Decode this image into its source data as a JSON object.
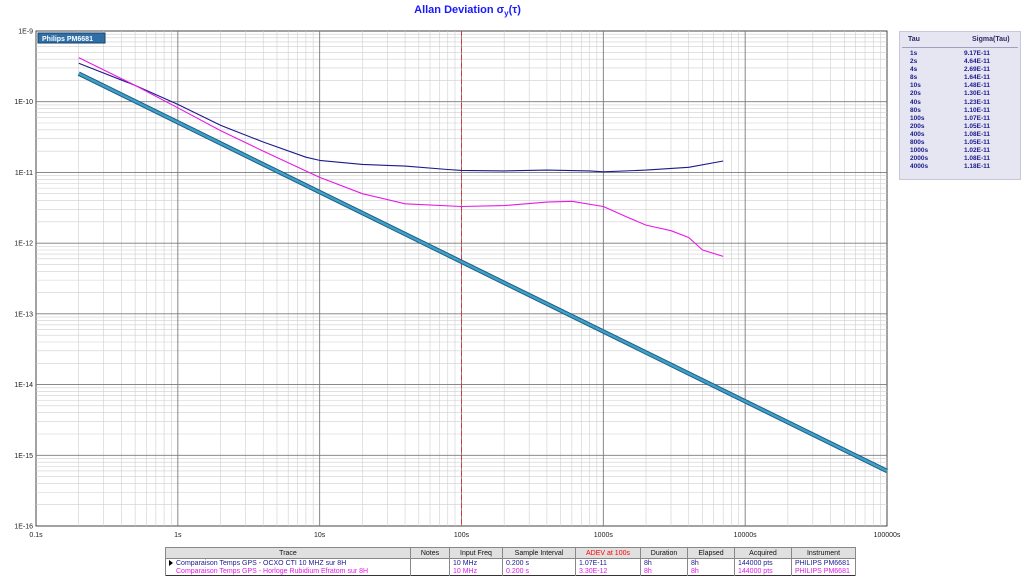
{
  "title": {
    "main": "Allan Deviation σ",
    "sub": "y",
    "tail": "(τ)"
  },
  "chart_data": {
    "type": "line",
    "x_scale": "log",
    "y_scale": "log",
    "xlim": [
      0.1,
      100000
    ],
    "ylim": [
      1e-16,
      1e-09
    ],
    "x_tick_labels": [
      "0.1s",
      "1s",
      "10s",
      "100s",
      "1000s",
      "10000s",
      "100000s"
    ],
    "y_tick_labels": [
      "1E-9",
      "1E-10",
      "1E-11",
      "1E-12",
      "1E-13",
      "1E-14",
      "1E-15",
      "1E-16"
    ],
    "grid": true,
    "marker_line_x": 100,
    "legend": {
      "label": "Philips PM6681",
      "placement": "top-left"
    },
    "series": [
      {
        "color": "#1a1a8c",
        "x": [
          0.2,
          0.5,
          1,
          2,
          4,
          8,
          10,
          20,
          40,
          80,
          100,
          200,
          400,
          800,
          1000,
          2000,
          4000,
          7000
        ],
        "y": [
          3.5e-10,
          1.7e-10,
          9.17e-11,
          4.64e-11,
          2.69e-11,
          1.64e-11,
          1.48e-11,
          1.3e-11,
          1.23e-11,
          1.1e-11,
          1.07e-11,
          1.05e-11,
          1.08e-11,
          1.05e-11,
          1.02e-11,
          1.08e-11,
          1.18e-11,
          1.45e-11
        ]
      },
      {
        "color": "#e619e6",
        "x": [
          0.2,
          0.5,
          1,
          2,
          4,
          10,
          20,
          40,
          100,
          200,
          400,
          600,
          1000,
          1500,
          2000,
          3000,
          4000,
          5000,
          7000
        ],
        "y": [
          4.2e-10,
          1.7e-10,
          8.2e-11,
          3.9e-11,
          2e-11,
          8.5e-12,
          5e-12,
          3.6e-12,
          3.3e-12,
          3.4e-12,
          3.8e-12,
          3.9e-12,
          3.3e-12,
          2.3e-12,
          1.8e-12,
          1.5e-12,
          1.2e-12,
          8e-13,
          6.5e-13
        ]
      },
      {
        "color": "#3fa0c8",
        "x": [
          0.2,
          100000
        ],
        "y": [
          2.5e-10,
          6e-16
        ]
      }
    ]
  },
  "tau_table": {
    "header_tau": "Tau",
    "header_sigma": "Sigma(Tau)",
    "rows": [
      {
        "tau": "1s",
        "sigma": "9.17E-11"
      },
      {
        "tau": "2s",
        "sigma": "4.64E-11"
      },
      {
        "tau": "4s",
        "sigma": "2.69E-11"
      },
      {
        "tau": "8s",
        "sigma": "1.64E-11"
      },
      {
        "tau": "10s",
        "sigma": "1.48E-11"
      },
      {
        "tau": "20s",
        "sigma": "1.30E-11"
      },
      {
        "tau": "40s",
        "sigma": "1.23E-11"
      },
      {
        "tau": "80s",
        "sigma": "1.10E-11"
      },
      {
        "tau": "100s",
        "sigma": "1.07E-11"
      },
      {
        "tau": "200s",
        "sigma": "1.05E-11"
      },
      {
        "tau": "400s",
        "sigma": "1.08E-11"
      },
      {
        "tau": "800s",
        "sigma": "1.05E-11"
      },
      {
        "tau": "1000s",
        "sigma": "1.02E-11"
      },
      {
        "tau": "2000s",
        "sigma": "1.08E-11"
      },
      {
        "tau": "4000s",
        "sigma": "1.18E-11"
      }
    ]
  },
  "info_table": {
    "headers": {
      "trace": "Trace",
      "notes": "Notes",
      "input_freq": "Input Freq",
      "sample_interval": "Sample Interval",
      "adev": "ADEV at 100s",
      "duration": "Duration",
      "elapsed": "Elapsed",
      "acquired": "Acquired",
      "instrument": "Instrument"
    },
    "rows": [
      {
        "trace": "Comparaison Temps GPS - OCXO CTI 10 MHZ sur 8H",
        "notes": "",
        "input_freq": "10 MHz",
        "sample_interval": "0.200 s",
        "adev": "1.07E-11",
        "duration": "8h",
        "elapsed": "8h",
        "acquired": "144000 pts",
        "instrument": "PHILIPS  PM6681"
      },
      {
        "trace": "Comparaison Temps GPS - Horloge Rubidium Efratom sur 8H",
        "notes": "",
        "input_freq": "10 MHz",
        "sample_interval": "0.200 s",
        "adev": "3.30E-12",
        "duration": "8h",
        "elapsed": "8h",
        "acquired": "144000 pts",
        "instrument": "PHILIPS  PM6681"
      }
    ]
  }
}
